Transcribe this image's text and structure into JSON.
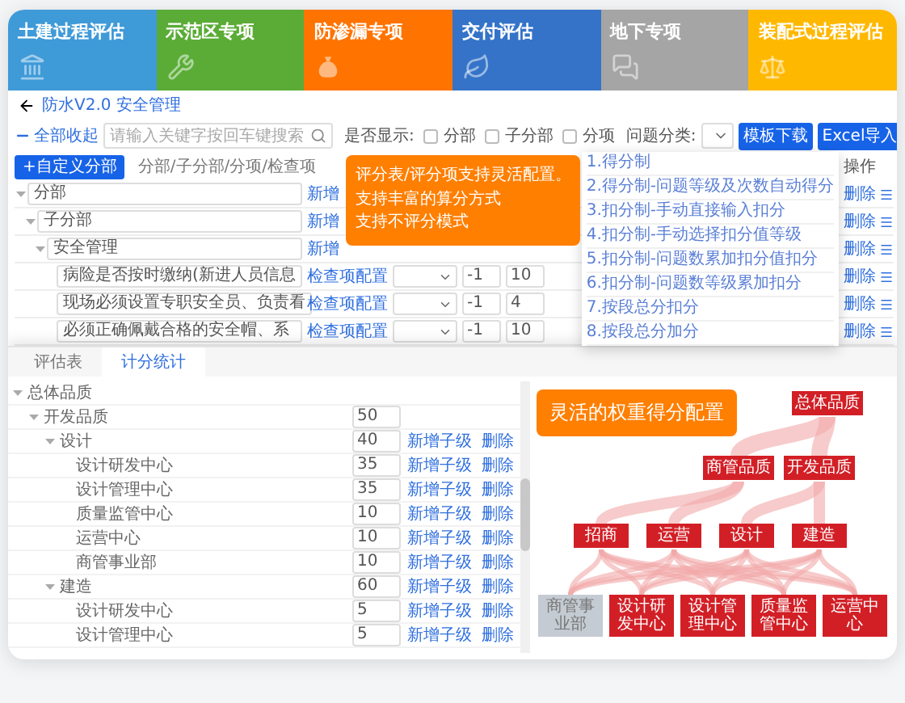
{
  "modules": [
    {
      "label": "土建过程评估",
      "color": "#3f9ad8"
    },
    {
      "label": "示范区专项",
      "color": "#5aac36"
    },
    {
      "label": "防渗漏专项",
      "color": "#ff7300"
    },
    {
      "label": "交付评估",
      "color": "#3473c8"
    },
    {
      "label": "地下专项",
      "color": "#a5a5a5"
    },
    {
      "label": "装配式过程评估",
      "color": "#ffb800"
    }
  ],
  "breadcrumb": "防水V2.0 安全管理",
  "toolbar": {
    "collapse_all": "全部收起",
    "search": {
      "placeholder": "请输入关键字按回车键搜索"
    },
    "display_label": "是否显示:",
    "display_options": [
      {
        "label": "分部",
        "checked": false
      },
      {
        "label": "子分部",
        "checked": false
      },
      {
        "label": "分项",
        "checked": false
      }
    ],
    "category_label": "问题分类:",
    "buttons": [
      "模板下载",
      "Excel导入"
    ]
  },
  "editor": {
    "add_button": "+自定义分部",
    "column_header": "分部/子分部/分项/检查项",
    "actions_header": "操作",
    "rows": [
      {
        "kind": "group",
        "label": "分部",
        "link": "新增",
        "action": "删除",
        "expanded": true,
        "children": [
          {
            "kind": "group",
            "label": "子分部",
            "link": "新增",
            "action": "删除",
            "expanded": true,
            "children": [
              {
                "kind": "group",
                "label": "安全管理",
                "link": "新增",
                "action": "删除",
                "expanded": true,
                "children": [
                  {
                    "kind": "item",
                    "label": "病险是否按时缴纳(新进人员信息",
                    "link": "检查项配置",
                    "deduct": "-1",
                    "score": "10",
                    "action": "删除"
                  },
                  {
                    "kind": "item",
                    "label": "现场必须设置专职安全员、负责看",
                    "link": "检查项配置",
                    "deduct": "-1",
                    "score": "4",
                    "action": "删除"
                  },
                  {
                    "kind": "item",
                    "label": "必须正确佩戴合格的安全帽、系",
                    "link": "检查项配置",
                    "deduct": "-1",
                    "score": "10",
                    "action": "删除"
                  }
                ]
              }
            ]
          }
        ]
      }
    ],
    "score_methods": [
      "1.得分制",
      "2.得分制-问题等级及次数自动得分",
      "3.扣分制-手动直接输入扣分",
      "4.扣分制-手动选择扣分值等级",
      "5.扣分制-问题数累加扣分值扣分",
      "6.扣分制-问题数等级累加扣分",
      "7.按段总分扣分",
      "8.按段总分加分"
    ],
    "callout": [
      "评分表/评分项支持灵活配置。",
      "支持丰富的算分方式",
      "支持不评分模式"
    ]
  },
  "lower": {
    "tabs": [
      {
        "label": "评估表",
        "selected": false
      },
      {
        "label": "计分统计",
        "selected": true
      }
    ],
    "rows": [
      {
        "label": "总体品质",
        "expanded": true,
        "children": [
          {
            "label": "开发品质",
            "value": "50",
            "expanded": true,
            "children": [
              {
                "label": "设计",
                "value": "40",
                "actions": [
                  "新增子级",
                  "删除"
                ],
                "expanded": true,
                "children": [
                  {
                    "label": "设计研发中心",
                    "value": "35",
                    "actions": [
                      "新增子级",
                      "删除"
                    ]
                  },
                  {
                    "label": "设计管理中心",
                    "value": "35",
                    "actions": [
                      "新增子级",
                      "删除"
                    ]
                  },
                  {
                    "label": "质量监管中心",
                    "value": "10",
                    "actions": [
                      "新增子级",
                      "删除"
                    ]
                  },
                  {
                    "label": "运营中心",
                    "value": "10",
                    "actions": [
                      "新增子级",
                      "删除"
                    ]
                  },
                  {
                    "label": "商管事业部",
                    "value": "10",
                    "actions": [
                      "新增子级",
                      "删除"
                    ]
                  }
                ]
              },
              {
                "label": "建造",
                "value": "60",
                "actions": [
                  "新增子级",
                  "删除"
                ],
                "expanded": true,
                "children": [
                  {
                    "label": "设计研发中心",
                    "value": "5",
                    "actions": [
                      "新增子级",
                      "删除"
                    ]
                  },
                  {
                    "label": "设计管理中心",
                    "value": "5",
                    "actions": [
                      "新增子级",
                      "删除"
                    ]
                  }
                ]
              }
            ]
          }
        ]
      }
    ],
    "callout": "灵活的权重得分配置",
    "sankey": {
      "levels": [
        [
          {
            "label": "总体品质",
            "dimmed": false
          }
        ],
        [
          {
            "label": "商管品质",
            "dimmed": false
          },
          {
            "label": "开发品质",
            "dimmed": false
          }
        ],
        [
          {
            "label": "招商",
            "dimmed": false
          },
          {
            "label": "运营",
            "dimmed": false
          },
          {
            "label": "设计",
            "dimmed": false
          },
          {
            "label": "建造",
            "dimmed": false
          }
        ],
        [
          {
            "label": "商管事业部",
            "dimmed": true
          },
          {
            "label": "设计研发中心",
            "dimmed": false
          },
          {
            "label": "设计管理中心",
            "dimmed": false
          },
          {
            "label": "质量监管中心",
            "dimmed": false
          },
          {
            "label": "运营中心",
            "dimmed": false
          }
        ]
      ]
    }
  }
}
